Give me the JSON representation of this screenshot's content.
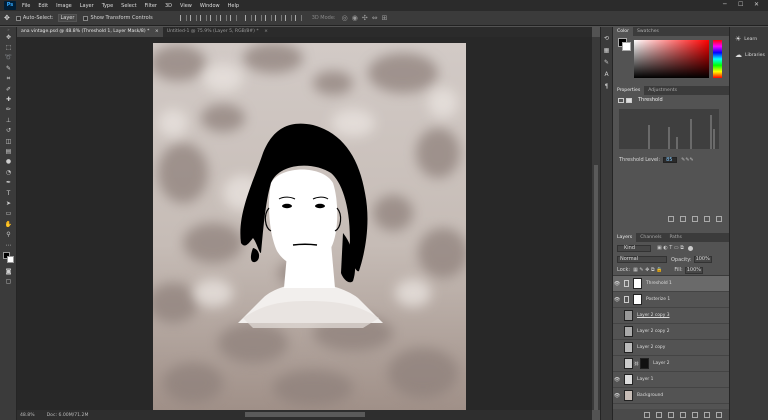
{
  "menubar": {
    "logo": "Ps",
    "items": [
      "File",
      "Edit",
      "Image",
      "Layer",
      "Type",
      "Select",
      "Filter",
      "3D",
      "View",
      "Window",
      "Help"
    ],
    "window_controls": [
      "─",
      "☐",
      "✕"
    ]
  },
  "options_bar": {
    "auto_select_label": "Auto-Select:",
    "auto_select_value": "Layer",
    "transform_label": "Show Transform Controls",
    "mode_3d": "3D Mode:"
  },
  "document_tabs": [
    {
      "label": "ana vintage.psd @ 48.8% (Threshold 1, Layer Mask/8) *",
      "active": true
    },
    {
      "label": "Untitled-1 @ 75.9% (Layer 5, RGB/8#) *",
      "active": false
    }
  ],
  "status_bar": {
    "zoom": "48.8%",
    "doc": "Doc: 6.00M/71.2M"
  },
  "panels": {
    "color_tabs": [
      "Color",
      "Swatches"
    ],
    "properties_tabs": [
      "Properties",
      "Adjustments"
    ],
    "properties_title": "Threshold",
    "threshold_label": "Threshold Level:",
    "threshold_value": "85",
    "layers_tabs": [
      "Layers",
      "Channels",
      "Paths"
    ],
    "kind_label": "Kind",
    "blend_mode": "Normal",
    "opacity_label": "Opacity:",
    "opacity_value": "100%",
    "lock_label": "Lock:",
    "fill_label": "Fill:",
    "fill_value": "100%",
    "layers": [
      {
        "name": "Threshold 1",
        "selected": true,
        "type": "adjustment"
      },
      {
        "name": "Posterize 1",
        "selected": false,
        "type": "adjustment"
      },
      {
        "name": "Layer 2 copy 3",
        "selected": false,
        "type": "pixel"
      },
      {
        "name": "Layer 2 copy 2",
        "selected": false,
        "type": "pixel"
      },
      {
        "name": "Layer 2 copy",
        "selected": false,
        "type": "pixel"
      },
      {
        "name": "Layer 2",
        "selected": false,
        "type": "masked"
      },
      {
        "name": "Layer 1",
        "selected": false,
        "type": "pixel"
      },
      {
        "name": "Background",
        "selected": false,
        "type": "pixel"
      }
    ]
  },
  "libraries": {
    "items": [
      "Learn",
      "Libraries"
    ]
  }
}
